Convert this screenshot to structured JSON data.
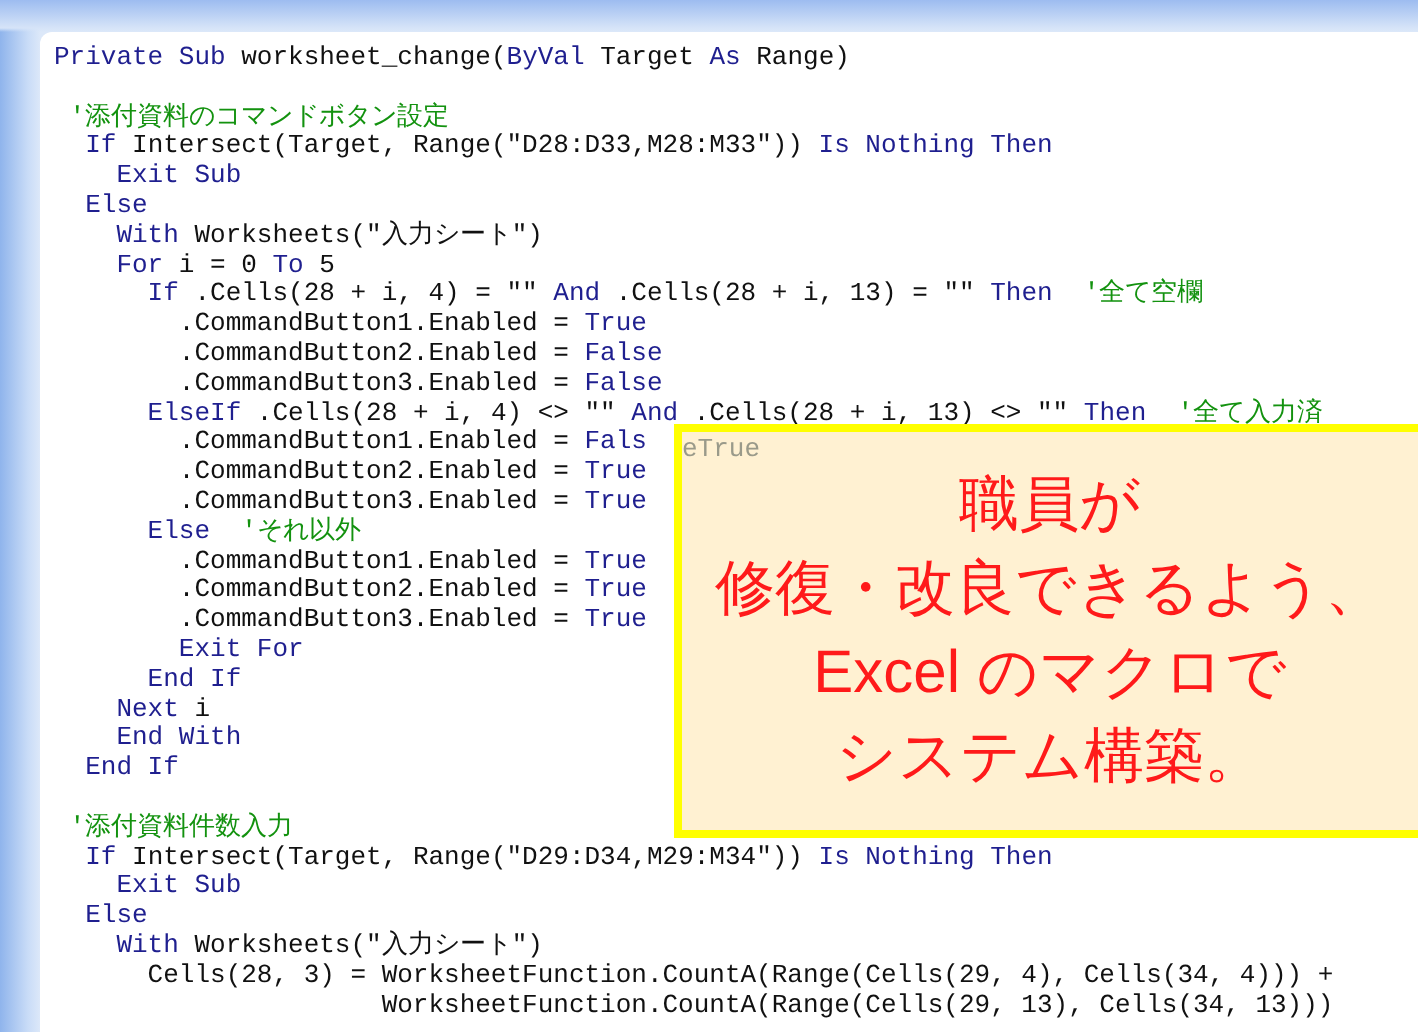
{
  "editor": {
    "lines": [
      {
        "kind": "code",
        "tokens": [
          {
            "kind": "keyword",
            "text": "Private Sub"
          },
          {
            "kind": "code",
            "text": " worksheet_change("
          },
          {
            "kind": "keyword",
            "text": "ByVal"
          },
          {
            "kind": "code",
            "text": " Target "
          },
          {
            "kind": "keyword",
            "text": "As"
          },
          {
            "kind": "code",
            "text": " Range)"
          }
        ]
      },
      {
        "kind": "blank"
      },
      {
        "kind": "code",
        "tokens": [
          {
            "kind": "comment",
            "text": " '添付資料のコマンドボタン設定"
          }
        ]
      },
      {
        "kind": "code",
        "tokens": [
          {
            "kind": "keyword",
            "text": "  If"
          },
          {
            "kind": "code",
            "text": " Intersect(Target, Range(\"D28:D33,M28:M33\")) "
          },
          {
            "kind": "keyword",
            "text": "Is Nothing Then"
          }
        ]
      },
      {
        "kind": "code",
        "tokens": [
          {
            "kind": "keyword",
            "text": "    Exit Sub"
          }
        ]
      },
      {
        "kind": "code",
        "tokens": [
          {
            "kind": "keyword",
            "text": "  Else"
          }
        ]
      },
      {
        "kind": "code",
        "tokens": [
          {
            "kind": "keyword",
            "text": "    With"
          },
          {
            "kind": "code",
            "text": " Worksheets(\"入力シート\")"
          }
        ]
      },
      {
        "kind": "code",
        "tokens": [
          {
            "kind": "keyword",
            "text": "    For"
          },
          {
            "kind": "code",
            "text": " i = 0 "
          },
          {
            "kind": "keyword",
            "text": "To"
          },
          {
            "kind": "code",
            "text": " 5"
          }
        ]
      },
      {
        "kind": "code",
        "tokens": [
          {
            "kind": "keyword",
            "text": "      If"
          },
          {
            "kind": "code",
            "text": " .Cells(28 + i, 4) = \"\" "
          },
          {
            "kind": "keyword",
            "text": "And"
          },
          {
            "kind": "code",
            "text": " .Cells(28 + i, 13) = \"\" "
          },
          {
            "kind": "keyword",
            "text": "Then"
          },
          {
            "kind": "comment",
            "text": "  '全て空欄"
          }
        ]
      },
      {
        "kind": "code",
        "tokens": [
          {
            "kind": "code",
            "text": "        .CommandButton1.Enabled = "
          },
          {
            "kind": "keyword",
            "text": "True"
          }
        ]
      },
      {
        "kind": "code",
        "tokens": [
          {
            "kind": "code",
            "text": "        .CommandButton2.Enabled = "
          },
          {
            "kind": "keyword",
            "text": "False"
          }
        ]
      },
      {
        "kind": "code",
        "tokens": [
          {
            "kind": "code",
            "text": "        .CommandButton3.Enabled = "
          },
          {
            "kind": "keyword",
            "text": "False"
          }
        ]
      },
      {
        "kind": "code",
        "tokens": [
          {
            "kind": "keyword",
            "text": "      ElseIf"
          },
          {
            "kind": "code",
            "text": " .Cells(28 + i, 4) <> \"\" "
          },
          {
            "kind": "keyword",
            "text": "And"
          },
          {
            "kind": "code",
            "text": " .Cells(28 + i, 13) <> \"\" "
          },
          {
            "kind": "keyword",
            "text": "Then"
          },
          {
            "kind": "comment",
            "text": "  '全て入力済"
          }
        ]
      },
      {
        "kind": "code",
        "tokens": [
          {
            "kind": "code",
            "text": "        .CommandButton1.Enabled = "
          },
          {
            "kind": "keyword",
            "text": "Fals"
          }
        ]
      },
      {
        "kind": "code",
        "tokens": [
          {
            "kind": "code",
            "text": "        .CommandButton2.Enabled = "
          },
          {
            "kind": "keyword",
            "text": "True"
          }
        ]
      },
      {
        "kind": "code",
        "tokens": [
          {
            "kind": "code",
            "text": "        .CommandButton3.Enabled = "
          },
          {
            "kind": "keyword",
            "text": "True"
          }
        ]
      },
      {
        "kind": "code",
        "tokens": [
          {
            "kind": "keyword",
            "text": "      Else"
          },
          {
            "kind": "comment",
            "text": "  'それ以外"
          }
        ]
      },
      {
        "kind": "code",
        "tokens": [
          {
            "kind": "code",
            "text": "        .CommandButton1.Enabled = "
          },
          {
            "kind": "keyword",
            "text": "True"
          }
        ]
      },
      {
        "kind": "code",
        "tokens": [
          {
            "kind": "code",
            "text": "        .CommandButton2.Enabled = "
          },
          {
            "kind": "keyword",
            "text": "True"
          }
        ]
      },
      {
        "kind": "code",
        "tokens": [
          {
            "kind": "code",
            "text": "        .CommandButton3.Enabled = "
          },
          {
            "kind": "keyword",
            "text": "True"
          }
        ]
      },
      {
        "kind": "code",
        "tokens": [
          {
            "kind": "keyword",
            "text": "        Exit For"
          }
        ]
      },
      {
        "kind": "code",
        "tokens": [
          {
            "kind": "keyword",
            "text": "      End If"
          }
        ]
      },
      {
        "kind": "code",
        "tokens": [
          {
            "kind": "keyword",
            "text": "    Next"
          },
          {
            "kind": "code",
            "text": " i"
          }
        ]
      },
      {
        "kind": "code",
        "tokens": [
          {
            "kind": "keyword",
            "text": "    End With"
          }
        ]
      },
      {
        "kind": "code",
        "tokens": [
          {
            "kind": "keyword",
            "text": "  End If"
          }
        ]
      },
      {
        "kind": "blank"
      },
      {
        "kind": "code",
        "tokens": [
          {
            "kind": "comment",
            "text": " '添付資料件数入力"
          }
        ]
      },
      {
        "kind": "code",
        "tokens": [
          {
            "kind": "keyword",
            "text": "  If"
          },
          {
            "kind": "code",
            "text": " Intersect(Target, Range(\"D29:D34,M29:M34\")) "
          },
          {
            "kind": "keyword",
            "text": "Is Nothing Then"
          }
        ]
      },
      {
        "kind": "code",
        "tokens": [
          {
            "kind": "keyword",
            "text": "    Exit Sub"
          }
        ]
      },
      {
        "kind": "code",
        "tokens": [
          {
            "kind": "keyword",
            "text": "  Else"
          }
        ]
      },
      {
        "kind": "code",
        "tokens": [
          {
            "kind": "keyword",
            "text": "    With"
          },
          {
            "kind": "code",
            "text": " Worksheets(\"入力シート\")"
          }
        ]
      },
      {
        "kind": "code",
        "tokens": [
          {
            "kind": "code",
            "text": "      Cells(28, 3) = WorksheetFunction.CountA(Range(Cells(29, 4), Cells(34, 4))) +"
          }
        ]
      },
      {
        "kind": "code",
        "tokens": [
          {
            "kind": "code",
            "text": "                     WorksheetFunction.CountA(Range(Cells(29, 13), Cells(34, 13)))"
          }
        ]
      }
    ]
  },
  "callout": {
    "ghost_text": "eTrue",
    "lines": [
      "職員が",
      "修復・改良できるよう、",
      "Excel のマクロで",
      "システム構築。"
    ]
  }
}
